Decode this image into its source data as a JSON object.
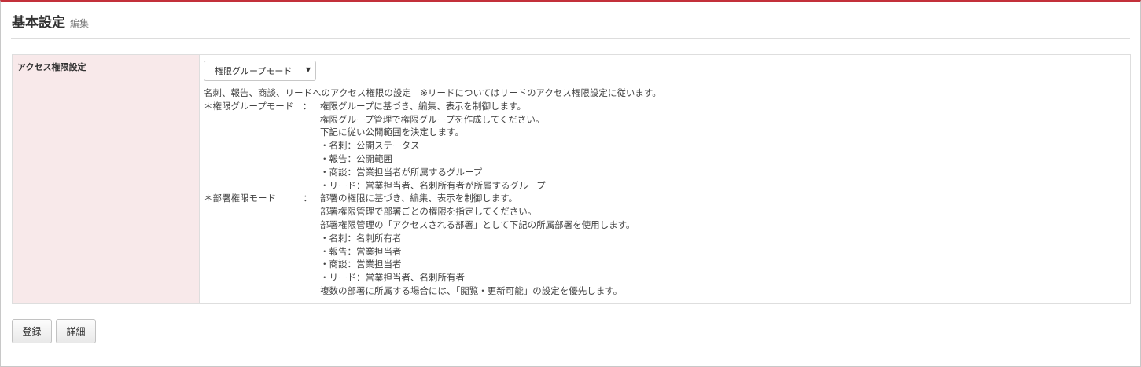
{
  "header": {
    "title": "基本設定",
    "subtitle": "編集"
  },
  "access_setting": {
    "label": "アクセス権限設定",
    "select": {
      "selected": "権限グループモード",
      "arrow_icon": "triangle-down-icon"
    },
    "intro": "名刺、報告、商談、リードへのアクセス権限の設定　※リードについてはリードのアクセス権限設定に従います。",
    "modes": [
      {
        "name": "＊権限グループモード　：",
        "lines": [
          "権限グループに基づき、編集、表示を制御します。",
          "権限グループ管理で権限グループを作成してください。",
          "下記に従い公開範囲を決定します。",
          "・名刺：公開ステータス",
          "・報告：公開範囲",
          "・商談：営業担当者が所属するグループ",
          "・リード：営業担当者、名刺所有者が所属するグループ"
        ]
      },
      {
        "name": "＊部署権限モード　　　：",
        "lines": [
          "部署の権限に基づき、編集、表示を制御します。",
          "部署権限管理で部署ごとの権限を指定してください。",
          "部署権限管理の「アクセスされる部署」として下記の所属部署を使用します。",
          "・名刺：名刺所有者",
          "・報告：営業担当者",
          "・商談：営業担当者",
          "・リード：営業担当者、名刺所有者",
          "複数の部署に所属する場合には、「閲覧・更新可能」の設定を優先します。"
        ]
      }
    ]
  },
  "buttons": {
    "register": "登録",
    "detail": "詳細"
  },
  "colors": {
    "top_accent": "#c3303a",
    "label_bg": "#f8e9ea"
  }
}
